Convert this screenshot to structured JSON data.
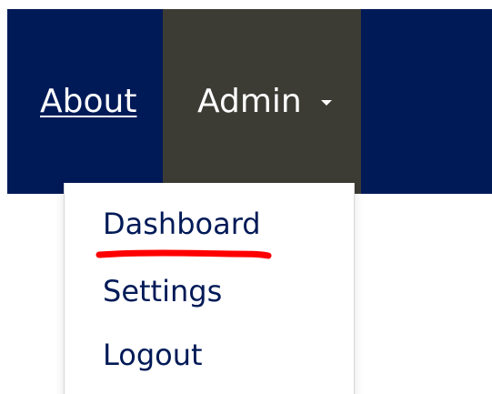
{
  "colors": {
    "navbar_bg": "#001A57",
    "active_nav_bg": "#3C3C35",
    "nav_text": "#FFFFFF",
    "menu_text": "#001A57",
    "highlight_underline": "#FF0000"
  },
  "nav": {
    "about_label": "About",
    "admin_label": "Admin",
    "admin_dropdown_icon": "caret-down-icon"
  },
  "dropdown": {
    "items": [
      {
        "label": "Dashboard"
      },
      {
        "label": "Settings"
      },
      {
        "label": "Logout"
      }
    ]
  }
}
